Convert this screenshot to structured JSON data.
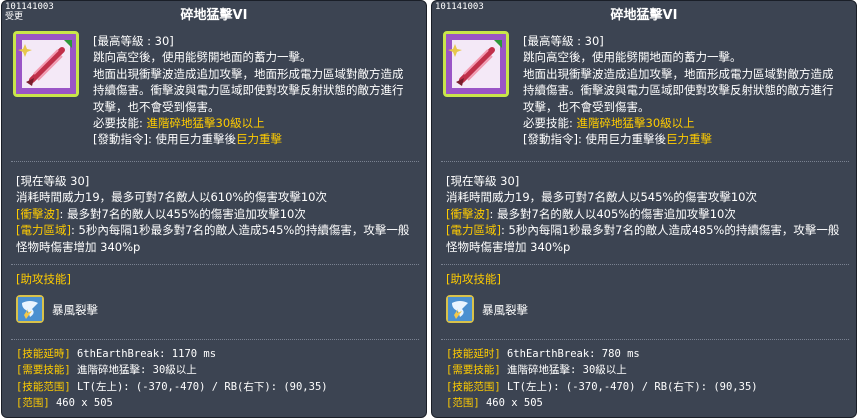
{
  "cards": [
    {
      "id_label": "101141003",
      "tag": "受更",
      "title": "碎地猛擊VI",
      "max_level": "[最高等級 : 30]",
      "desc1": "跳向高空後，使用能劈開地面的蓄力一擊。",
      "desc2": "地面出現衝擊波造成追加攻擊，地面形成電力區域對敵方造成",
      "desc3": "持續傷害。衝擊波與電力區域即使對攻擊反射狀態的敵方進行",
      "desc4": "攻擊，也不會受到傷害。",
      "req_label": "必要技能: ",
      "req_value": "進階碎地猛擊30級以上",
      "cmd_label": "[發動指令]: 使用巨力重擊後",
      "cmd_value": "巨力重擊",
      "current_header": "[現在等級 30]",
      "current1": "消耗時間威力19，最多可對7名敵人以610%的傷害攻擊10次",
      "shock_label": "[衝擊波]",
      "shock_text": ": 最多對7名的敵人以455%的傷害追加攻擊10次",
      "zone_label": "[電力區域]",
      "zone_text": ": 5秒內每隔1秒最多對7名的敵人造成545%的持續傷害，攻擊一般",
      "zone_text2": "怪物時傷害增加 340%p",
      "assist_header": "[助攻技能]",
      "assist_name": "暴風裂擊",
      "meta": [
        {
          "label": "[技能延時]",
          "value": " 6thEarthBreak: 1170 ms"
        },
        {
          "label": "[需要技能]",
          "value": " 進階碎地猛擊: 30級以上"
        },
        {
          "label": "[技能范围]",
          "value": " LT(左上): (-370,-470) / RB(右下): (90,35)"
        },
        {
          "label": "[范围]",
          "value": " 460 x 505"
        }
      ]
    },
    {
      "id_label": "101141003",
      "tag": "",
      "title": "碎地猛擊VI",
      "max_level": "[最高等級 : 30]",
      "desc1": "跳向高空後，使用能劈開地面的蓄力一擊。",
      "desc2": "地面出現衝擊波造成追加攻擊，地面形成電力區域對敵方造成",
      "desc3": "持續傷害。衝擊波與電力區域即使對攻擊反射狀態的敵方進行",
      "desc4": "攻擊，也不會受到傷害。",
      "req_label": "必要技能: ",
      "req_value": "進階碎地猛擊30級以上",
      "cmd_label": "[發動指令]: 使用巨力重擊後",
      "cmd_value": "巨力重擊",
      "current_header": "[現在等級 30]",
      "current1": "消耗時間威力19，最多可對7名敵人以545%的傷害攻擊10次",
      "shock_label": "[衝擊波]",
      "shock_text": ": 最多對7名的敵人以405%的傷害追加攻擊10次",
      "zone_label": "[電力區域]",
      "zone_text": ": 5秒內每隔1秒最多對7名的敵人造成485%的持續傷害，攻擊一般",
      "zone_text2": "怪物時傷害增加 340%p",
      "assist_header": "[助攻技能]",
      "assist_name": "暴風裂擊",
      "meta": [
        {
          "label": "[技能延时]",
          "value": " 6thEarthBreak: 780 ms"
        },
        {
          "label": "[需要技能]",
          "value": " 進階碎地猛擊: 30級以上"
        },
        {
          "label": "[技能范围]",
          "value": " LT(左上): (-370,-470) / RB(右下): (90,35)"
        },
        {
          "label": "[范围]",
          "value": " 460 x 505"
        }
      ]
    }
  ]
}
